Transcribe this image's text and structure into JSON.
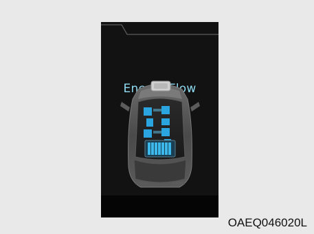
{
  "screen": {
    "title": "Energy Flow"
  },
  "figure_code": "OAEQ046020L",
  "colors": {
    "background": "#e9e9e9",
    "display": "#121212",
    "title_text": "#8fdcf3",
    "flow_highlight": "#2aa5e0",
    "battery": "#3cb9ea"
  },
  "icons": {
    "car": "car-top-view-icon",
    "battery": "battery-icon",
    "engine": "engine-icon"
  }
}
